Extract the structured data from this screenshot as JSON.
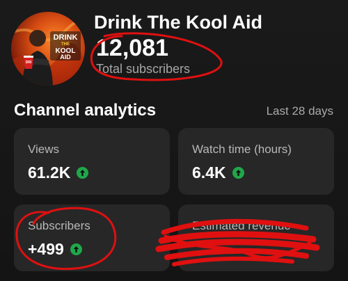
{
  "channel": {
    "name": "Drink The Kool Aid",
    "subscriber_count": "12,081",
    "subscriber_label": "Total subscribers",
    "avatar_logo_text": "DRINK THE KOOL AID"
  },
  "analytics": {
    "title": "Channel analytics",
    "period": "Last 28 days",
    "cards": [
      {
        "label": "Views",
        "value": "61.2K",
        "trend_icon": "arrow-up-circle-icon"
      },
      {
        "label": "Watch time (hours)",
        "value": "6.4K",
        "trend_icon": "arrow-up-circle-icon"
      },
      {
        "label": "Subscribers",
        "value": "+499",
        "trend_icon": "arrow-up-circle-icon"
      },
      {
        "label": "Estimated revenue",
        "value": "",
        "redacted": true
      }
    ]
  },
  "colors": {
    "background": "#151515",
    "card": "#272727",
    "trend_up": "#1fa84a",
    "annotation": "#e01010"
  }
}
